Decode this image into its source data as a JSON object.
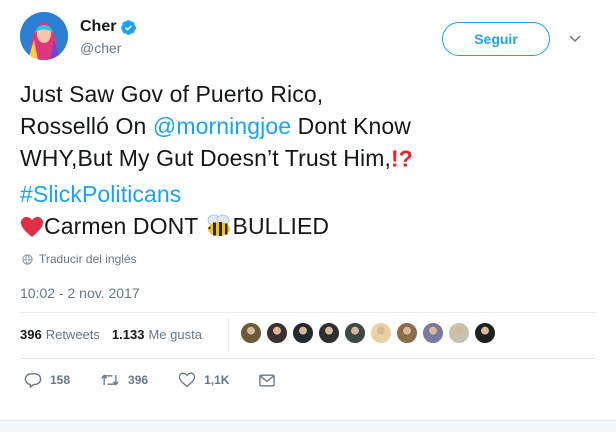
{
  "user": {
    "display_name": "Cher",
    "handle": "@cher",
    "follow_label": "Seguir"
  },
  "tweet": {
    "line1": "Just Saw Gov of Puerto Rico,",
    "line2_pre": "Rosselló On ",
    "line2_mention": "@morningjoe",
    "line2_post": " Dont Know",
    "line3": "WHY,But My Gut Doesn’t Trust Him,",
    "line3_emoji": "⁉️",
    "hashtag": "#SlickPoliticans",
    "line5_a": "Carmen DONT ",
    "line5_b": "BULLIED"
  },
  "translate_label": "Traducir del inglés",
  "timestamp": "10:02 - 2 nov. 2017",
  "stats": {
    "retweets_count": "396",
    "retweets_label": "Retweets",
    "likes_count": "1.133",
    "likes_label": "Me gusta"
  },
  "likers_colors": [
    "#6b5a3a",
    "#3a3030",
    "#1f2a33",
    "#2e2e2e",
    "#3c4a44",
    "#e6d2a2",
    "#8a6b4a",
    "#7a7aa0",
    "#c9c2b0",
    "#202020"
  ],
  "actions": {
    "replies": "158",
    "retweets": "396",
    "likes": "1,1K"
  },
  "colors": {
    "accent": "#1da1f2",
    "muted": "#657786"
  }
}
